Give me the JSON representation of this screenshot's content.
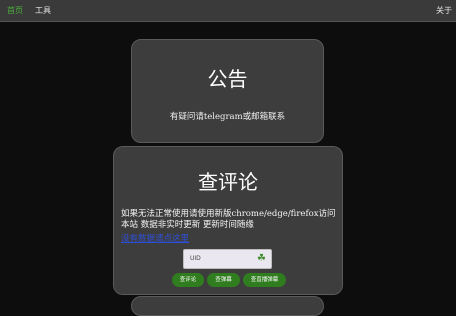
{
  "nav": {
    "brand": "首页",
    "tools": "工具",
    "about": "关于"
  },
  "notice": {
    "title": "公告",
    "body": "有疑问请telegram或邮箱联系"
  },
  "review": {
    "title": "查评论",
    "desc": "如果无法正常使用请使用新版chrome/edge/firefox访问本站 数据非实时更新 更新时间随缘",
    "link": "没有数据请点这里",
    "uid_placeholder": "UID",
    "btn_review": "查评论",
    "btn_recent": "查弹幕",
    "btn_live": "查直播弹幕"
  },
  "colors": {
    "accent_green": "#4caf3c",
    "button_green": "#2f7d1e",
    "link_blue": "#2d4fd8"
  }
}
